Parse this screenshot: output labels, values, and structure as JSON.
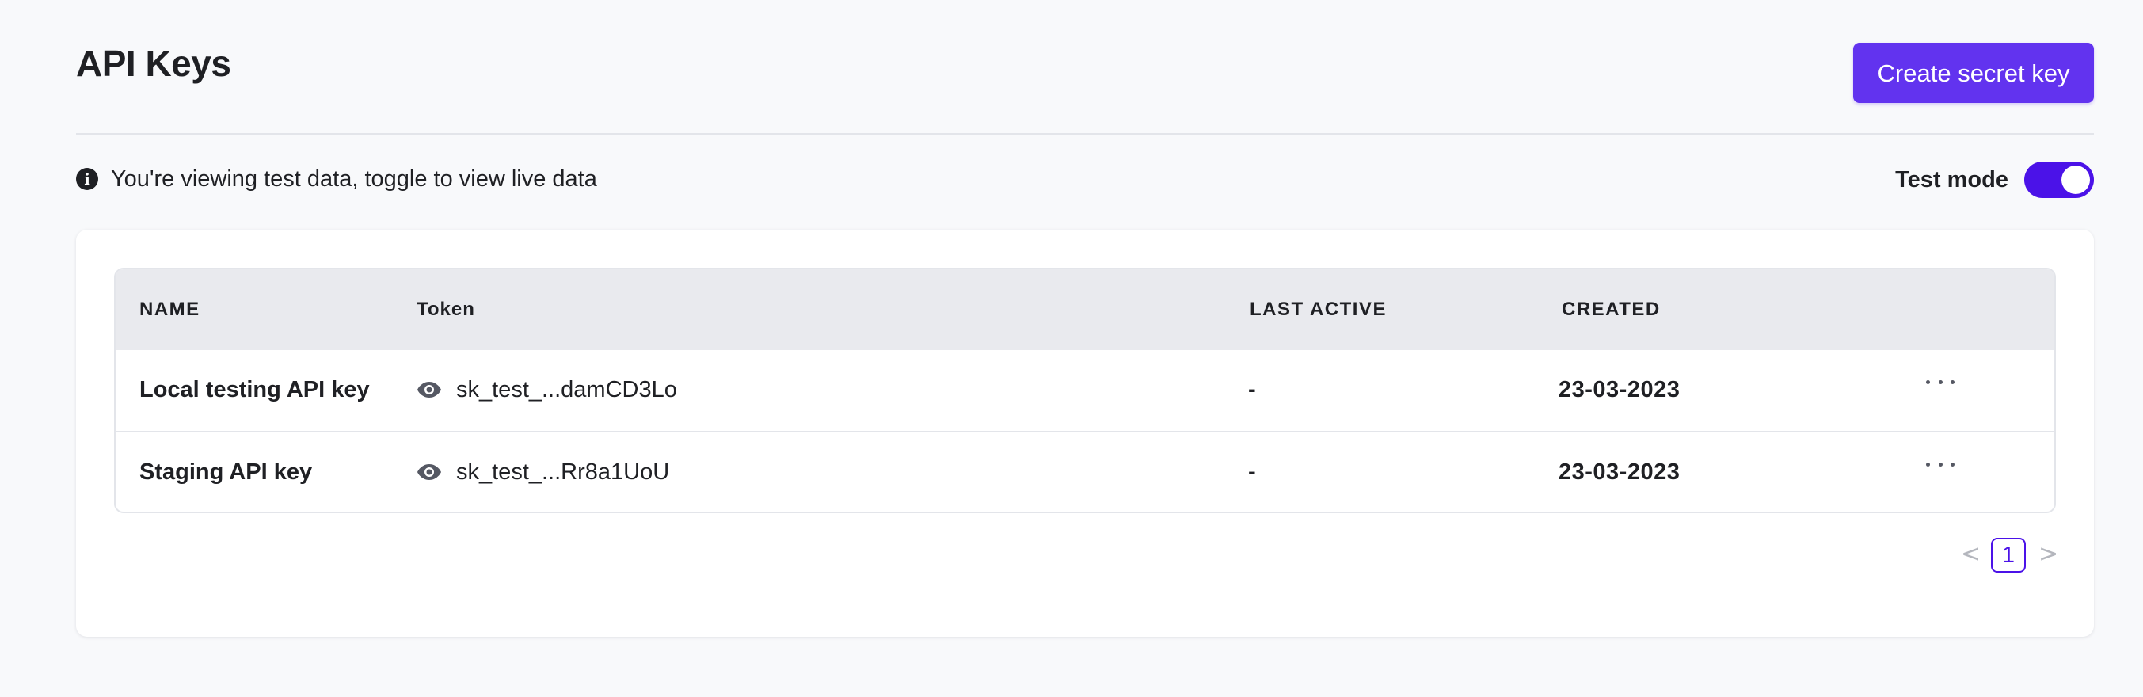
{
  "header": {
    "title": "API Keys",
    "create_button_label": "Create secret key"
  },
  "notice": {
    "icon": "info-icon",
    "text": "You're viewing test data, toggle to view live data"
  },
  "mode": {
    "label": "Test mode",
    "enabled": true
  },
  "table": {
    "columns": [
      "NAME",
      "Token",
      "LAST ACTIVE",
      "CREATED"
    ],
    "rows": [
      {
        "name": "Local testing API key",
        "token": "sk_test_...damCD3Lo",
        "last_active": "-",
        "created": "23-03-2023"
      },
      {
        "name": "Staging API key",
        "token": "sk_test_...Rr8a1UoU",
        "last_active": "-",
        "created": "23-03-2023"
      }
    ]
  },
  "pagination": {
    "prev": "<",
    "current": "1",
    "next": ">"
  },
  "colors": {
    "accent": "#6233ef",
    "toggle": "#4b12e8",
    "background": "#f8f9fb",
    "table_header": "#e9eaee"
  }
}
